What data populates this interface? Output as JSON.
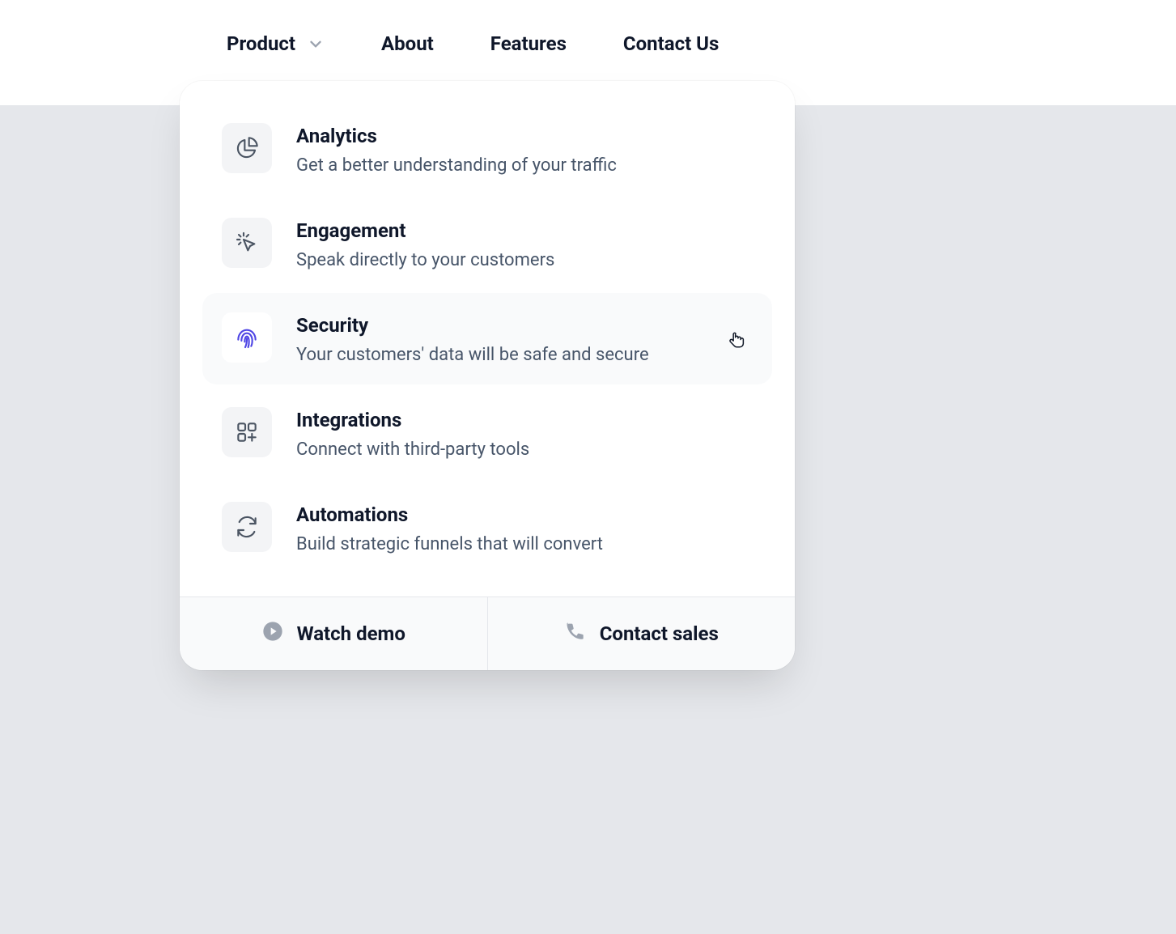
{
  "nav": {
    "items": [
      {
        "label": "Product",
        "has_dropdown": true
      },
      {
        "label": "About",
        "has_dropdown": false
      },
      {
        "label": "Features",
        "has_dropdown": false
      },
      {
        "label": "Contact Us",
        "has_dropdown": false
      }
    ]
  },
  "flyout": {
    "items": [
      {
        "title": "Analytics",
        "desc": "Get a better understanding of your traffic",
        "icon": "chart-pie-icon",
        "hovered": false
      },
      {
        "title": "Engagement",
        "desc": "Speak directly to your customers",
        "icon": "cursor-click-icon",
        "hovered": false
      },
      {
        "title": "Security",
        "desc": "Your customers' data will be safe and secure",
        "icon": "fingerprint-icon",
        "hovered": true
      },
      {
        "title": "Integrations",
        "desc": "Connect with third-party tools",
        "icon": "squares-plus-icon",
        "hovered": false
      },
      {
        "title": "Automations",
        "desc": "Build strategic funnels that will convert",
        "icon": "refresh-icon",
        "hovered": false
      }
    ],
    "footer": [
      {
        "label": "Watch demo",
        "icon": "play-circle-icon"
      },
      {
        "label": "Contact sales",
        "icon": "phone-icon"
      }
    ]
  },
  "colors": {
    "accent": "#4f46e5",
    "icon": "#4b5563",
    "footer_icon": "#9ca3af"
  }
}
